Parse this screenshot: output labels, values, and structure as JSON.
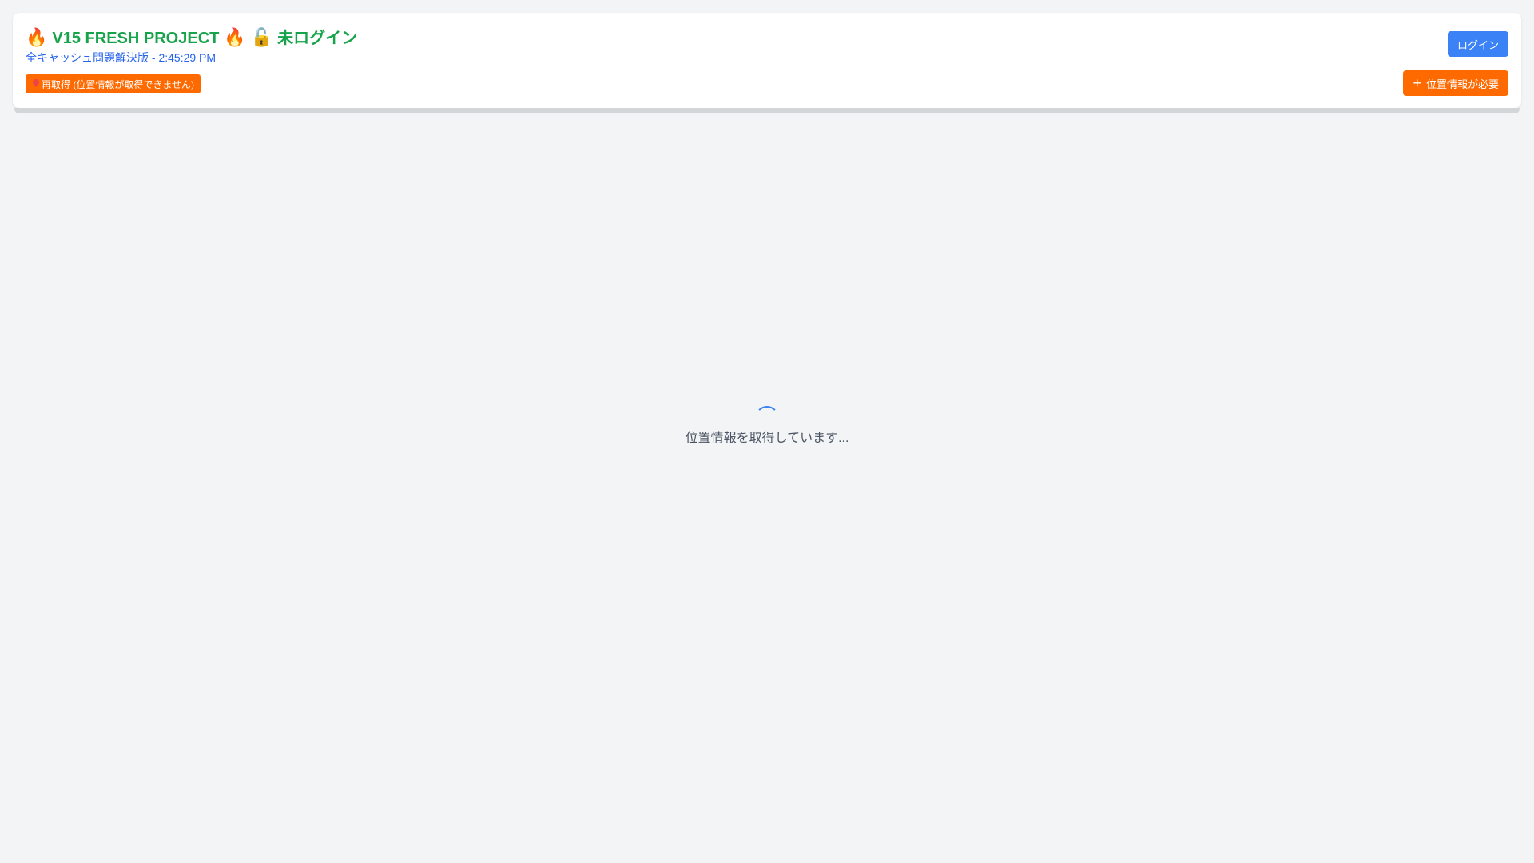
{
  "header": {
    "flame_left": "🔥",
    "title": "V15 FRESH PROJECT",
    "flame_right": "🔥",
    "lock_emoji": "🔓",
    "login_status": "未ログイン",
    "subtitle": "全キャッシュ問題解決版 - 2:45:29 PM",
    "refetch_label": "再取得 (位置情報が取得できません)",
    "login_label": "ログイン",
    "location_needed_label": "位置情報が必要",
    "plus_symbol": "+"
  },
  "main": {
    "loading_text": "位置情報を取得しています..."
  },
  "colors": {
    "title_green": "#16a34a",
    "subtitle_blue": "#2563eb",
    "orange": "#ff6a00",
    "login_blue": "#3b82f6",
    "background": "#f3f4f6"
  }
}
